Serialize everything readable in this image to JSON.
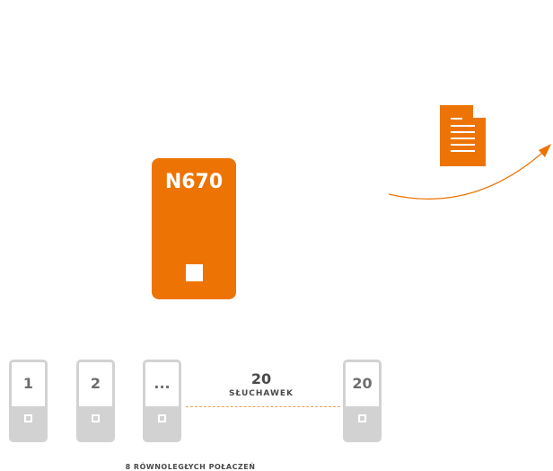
{
  "base_station": {
    "model": "N670",
    "color": "#ed7404"
  },
  "document": {
    "icon": "document-icon",
    "color": "#ed7404"
  },
  "arrow": {
    "icon": "curved-arrow",
    "color": "#ed7404"
  },
  "handsets": {
    "items": [
      {
        "label": "1"
      },
      {
        "label": "2"
      },
      {
        "label": "..."
      },
      {
        "label": "20"
      }
    ],
    "count": "20",
    "count_word": "SŁUCHAWEK",
    "color": "#d2d2d2"
  },
  "footer": {
    "parallel_calls": "8 RÓWNOLEGŁYCH POŁACZEŃ"
  }
}
